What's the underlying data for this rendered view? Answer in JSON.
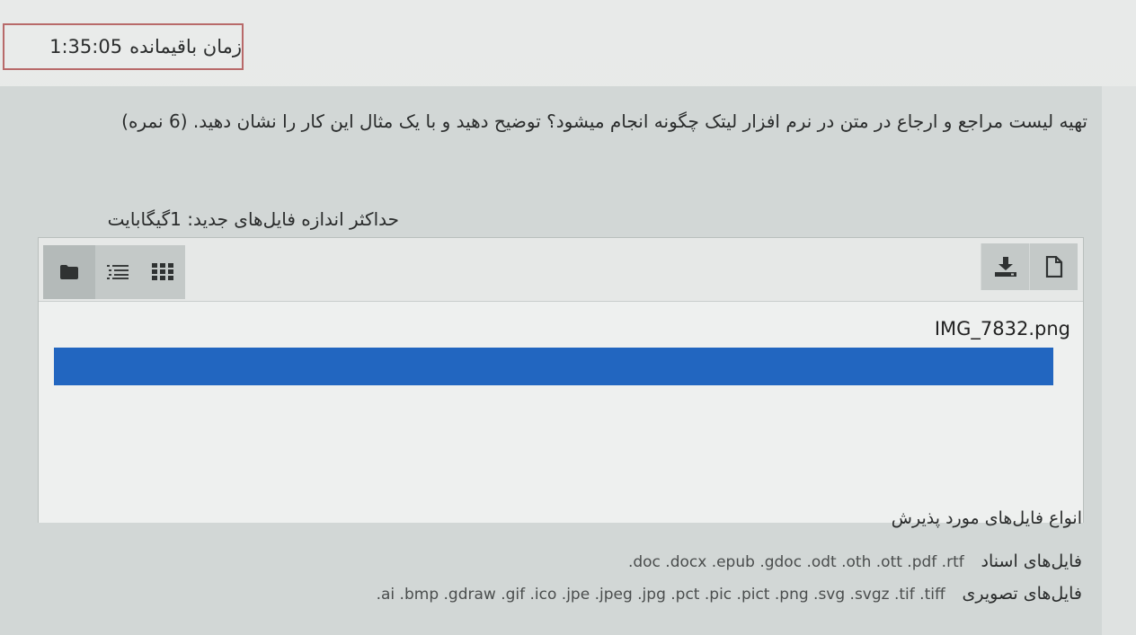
{
  "timer": {
    "label": "زمان باقیمانده",
    "value": "1:35:05"
  },
  "question": {
    "text": "تهیه لیست مراجع و ارجاع در متن در نرم افزار لیتک چگونه انجام میشود؟ توضیح دهید و با یک مثال این کار را نشان دهید. (6 نمره)"
  },
  "upload": {
    "max_size_label": "حداکثر اندازه فایل‌های جدید: 1گیگابایت",
    "toolbar": {
      "view_buttons": [
        "folder-icon",
        "list-icon",
        "grid-icon"
      ],
      "action_buttons": [
        "download-icon",
        "new-file-icon"
      ]
    },
    "file": {
      "name": "IMG_7832.png",
      "progress_percent": 100,
      "progress_color": "#2266c0"
    }
  },
  "accepted_types": {
    "title": "انواع فایل‌های مورد پذیرش",
    "documents": {
      "label": "فایل‌های اسناد",
      "extensions": ".doc .docx .epub .gdoc .odt .oth .ott .pdf .rtf"
    },
    "images": {
      "label": "فایل‌های تصویری",
      "extensions": ".ai .bmp .gdraw .gif .ico .jpe .jpeg .jpg .pct .pic .pict .png .svg .svgz .tif .tiff"
    }
  }
}
